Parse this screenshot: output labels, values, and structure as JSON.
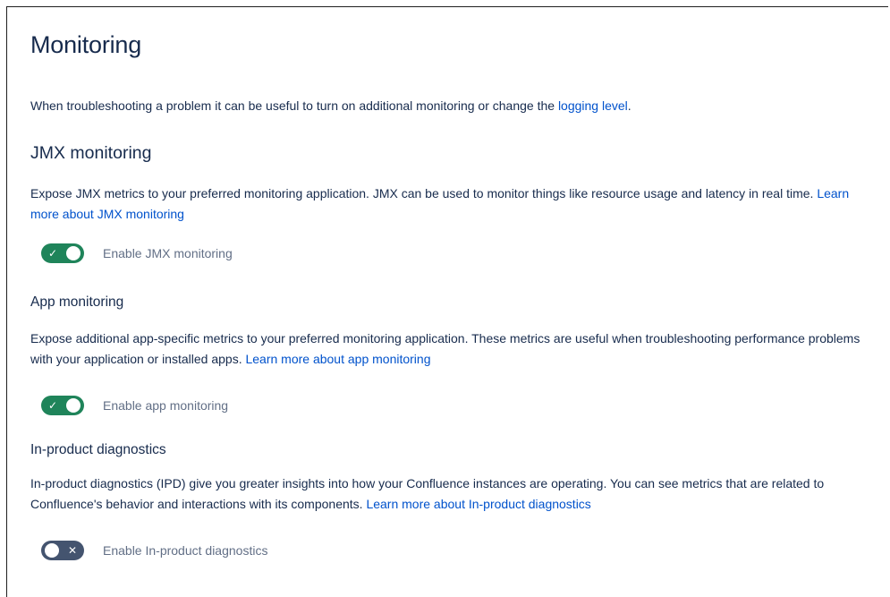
{
  "page": {
    "title": "Monitoring",
    "intro_text": "When troubleshooting a problem it can be useful to turn on additional monitoring or change the ",
    "intro_link": "logging level",
    "intro_end": "."
  },
  "jmx": {
    "heading": "JMX monitoring",
    "description": "Expose JMX metrics to your preferred monitoring application. JMX can be used to monitor things like resource usage and latency in real time. ",
    "link": "Learn more about JMX monitoring",
    "toggle_label": "Enable JMX monitoring",
    "enabled": true
  },
  "app": {
    "heading": "App monitoring",
    "description": "Expose additional app-specific metrics to your preferred monitoring application. These metrics are useful when troubleshooting performance problems with your application or installed apps. ",
    "link": "Learn more about app monitoring",
    "toggle_label": "Enable app monitoring",
    "enabled": true
  },
  "ipd": {
    "heading": "In-product diagnostics",
    "description": "In-product diagnostics (IPD) give you greater insights into how your Confluence instances are operating. You can see metrics that are related to Confluence's behavior and interactions with its components. ",
    "link": "Learn more about In-product diagnostics",
    "toggle_label": "Enable In-product diagnostics",
    "enabled": false
  },
  "icons": {
    "check": "✓",
    "cross": "✕"
  },
  "colors": {
    "toggle_on": "#1f845a",
    "toggle_off": "#44546f",
    "link": "#0052cc",
    "text": "#172b4d"
  }
}
